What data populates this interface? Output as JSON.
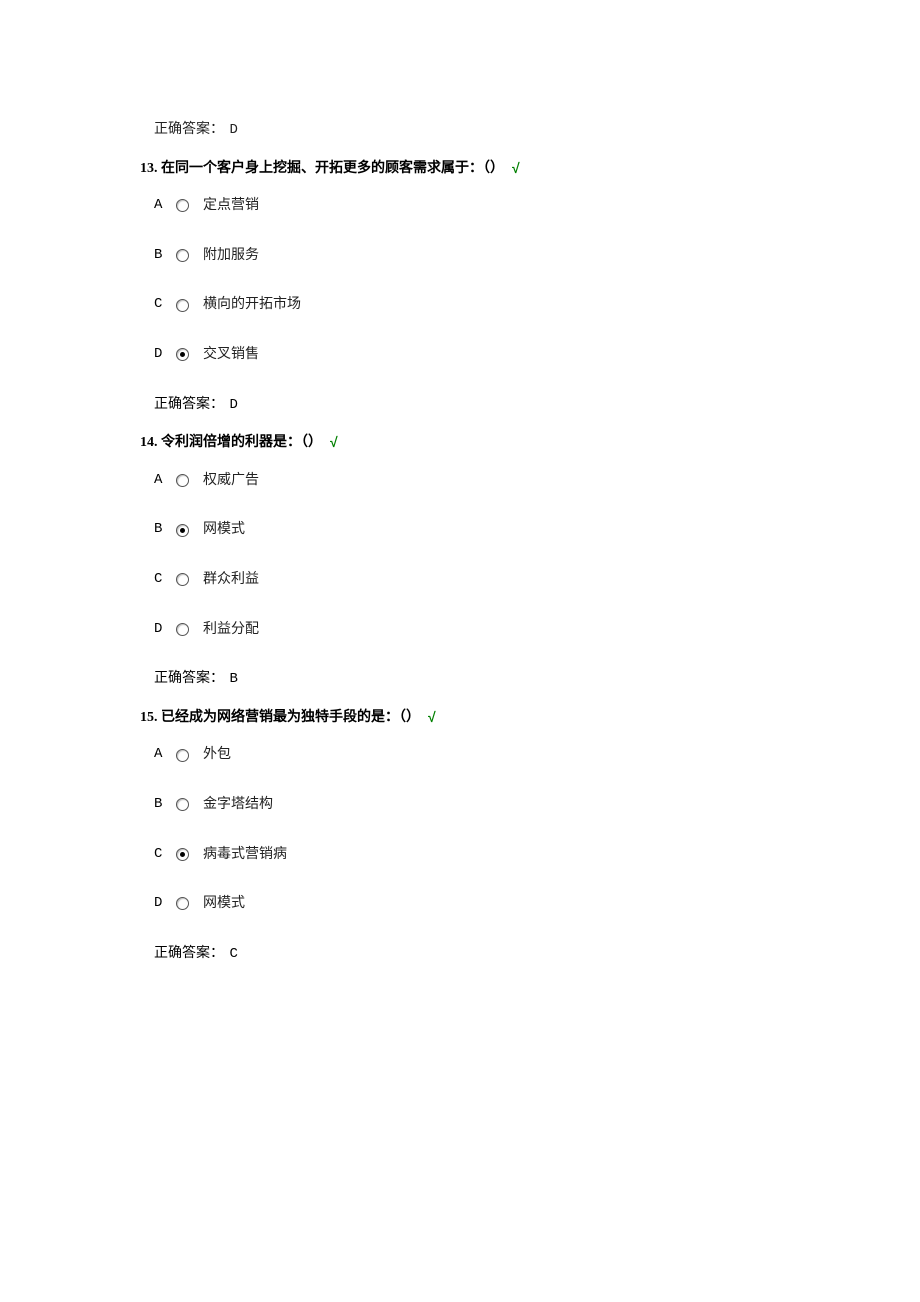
{
  "top_answer": {
    "label": "正确答案： ",
    "value": "D"
  },
  "questions": [
    {
      "number": "13. ",
      "text": "在同一个客户身上挖掘、开拓更多的顾客需求属于：（）",
      "check": "√",
      "options": [
        {
          "letter": "A",
          "text": "定点营销",
          "selected": false
        },
        {
          "letter": "B",
          "text": "附加服务",
          "selected": false
        },
        {
          "letter": "C",
          "text": "横向的开拓市场",
          "selected": false
        },
        {
          "letter": "D",
          "text": "交叉销售",
          "selected": true
        }
      ],
      "answer_label": "正确答案： ",
      "answer_value": "D"
    },
    {
      "number": "14. ",
      "text": "令利润倍增的利器是：（）",
      "check": "√",
      "options": [
        {
          "letter": "A",
          "text": "权威广告",
          "selected": false
        },
        {
          "letter": "B",
          "text": "网模式",
          "selected": true
        },
        {
          "letter": "C",
          "text": "群众利益",
          "selected": false
        },
        {
          "letter": "D",
          "text": "利益分配",
          "selected": false
        }
      ],
      "answer_label": "正确答案： ",
      "answer_value": "B"
    },
    {
      "number": "15. ",
      "text": "已经成为网络营销最为独特手段的是：（）",
      "check": "√",
      "options": [
        {
          "letter": "A",
          "text": "外包",
          "selected": false
        },
        {
          "letter": "B",
          "text": "金字塔结构",
          "selected": false
        },
        {
          "letter": "C",
          "text": "病毒式营销病",
          "selected": true
        },
        {
          "letter": "D",
          "text": "网模式",
          "selected": false
        }
      ],
      "answer_label": "正确答案： ",
      "answer_value": "C"
    }
  ]
}
